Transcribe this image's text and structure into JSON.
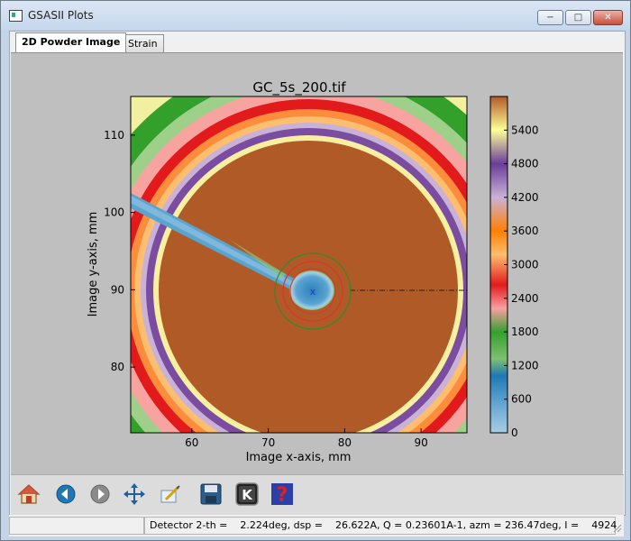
{
  "window": {
    "title": "GSASII Plots",
    "controls": {
      "minimize": "−",
      "maximize": "□",
      "close": "✕"
    }
  },
  "tabs": [
    {
      "label": "2D Powder Image",
      "active": true
    },
    {
      "label": "Strain",
      "active": false
    }
  ],
  "plot": {
    "title": "GC_5s_200.tif",
    "xlabel": "Image x-axis, mm",
    "ylabel": "Image y-axis, mm",
    "x_ticks": [
      "60",
      "70",
      "80",
      "90"
    ],
    "y_ticks": [
      "80",
      "90",
      "100",
      "110"
    ],
    "colorbar_ticks": [
      "0",
      "600",
      "1200",
      "1800",
      "2400",
      "3000",
      "3600",
      "4200",
      "4800",
      "5400"
    ],
    "beam_center_marker": "x"
  },
  "chart_data": {
    "type": "heatmap",
    "title": "GC_5s_200.tif",
    "xlabel": "Image x-axis, mm",
    "ylabel": "Image y-axis, mm",
    "xlim": [
      52,
      96
    ],
    "ylim": [
      71.5,
      115
    ],
    "colorbar_range": [
      0,
      6000
    ],
    "colorbar_ticks": [
      0,
      600,
      1200,
      1800,
      2400,
      3000,
      3600,
      4200,
      4800,
      5400
    ],
    "beam_center": [
      76.5,
      90
    ],
    "colormap": "Paired_r"
  },
  "toolbar": {
    "items": [
      {
        "name": "home-icon"
      },
      {
        "name": "back-icon"
      },
      {
        "name": "forward-icon"
      },
      {
        "name": "pan-icon"
      },
      {
        "name": "configure-subplots-icon"
      },
      {
        "name": "save-icon"
      },
      {
        "name": "k-key-icon"
      },
      {
        "name": "help-icon"
      }
    ]
  },
  "status": {
    "readout": "Detector 2-th =    2.224deg, dsp =    26.622A, Q = 0.23601A-1, azm = 236.47deg, I =    4924"
  },
  "colors": {
    "orange_interior": "#b05a28",
    "ring_cream": "#f7f0a0",
    "ring_purple": "#7a4da0",
    "ring_orange": "#f5901e",
    "ring_red": "#e02020",
    "ring_green": "#33a02c",
    "blue_streak": "#5aa4d0",
    "cursor_red": "#e03030",
    "cursor_green": "#2e8b2e"
  }
}
